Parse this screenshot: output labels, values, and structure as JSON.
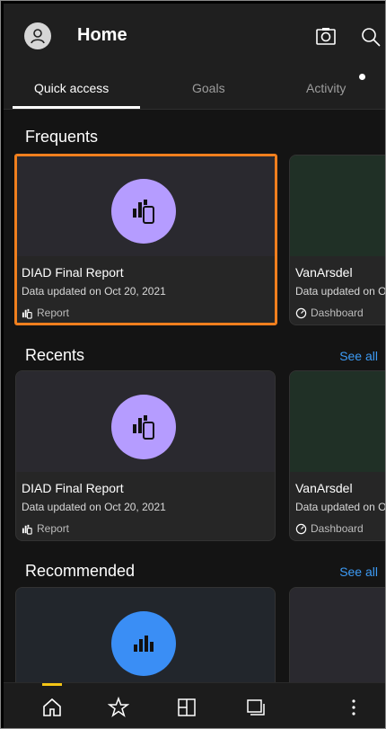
{
  "header": {
    "title": "Home",
    "icons": [
      "user-icon",
      "camera-icon",
      "search-icon"
    ]
  },
  "tabs": [
    {
      "label": "Quick access",
      "active": true
    },
    {
      "label": "Goals",
      "active": false
    },
    {
      "label": "Activity",
      "active": false,
      "has_notification_dot": true
    }
  ],
  "frequents": {
    "title": "Frequents",
    "cards": [
      {
        "name": "DIAD Final Report",
        "updated": "Data updated on Oct 20, 2021",
        "type": "Report",
        "icon": "report-icon",
        "selected": true
      },
      {
        "name": "VanArsdel",
        "updated": "Data updated on O",
        "type": "Dashboard",
        "icon": "dashboard-icon"
      }
    ]
  },
  "recents": {
    "title": "Recents",
    "see_all": "See all",
    "cards": [
      {
        "name": "DIAD Final Report",
        "updated": "Data updated on Oct 20, 2021",
        "type": "Report",
        "icon": "report-icon"
      },
      {
        "name": "VanArsdel",
        "updated": "Data updated on O",
        "type": "Dashboard",
        "icon": "dashboard-icon"
      }
    ]
  },
  "recommended": {
    "title": "Recommended",
    "see_all": "See all"
  },
  "bottom_nav": [
    {
      "name": "home-icon",
      "active": true
    },
    {
      "name": "star-icon"
    },
    {
      "name": "apps-icon"
    },
    {
      "name": "workspaces-icon"
    },
    {
      "name": "more-icon"
    }
  ],
  "colors": {
    "accent_blue": "#3d9bf5",
    "report_purple": "#b59cff",
    "selection_orange": "#f07f1e",
    "nav_active_yellow": "#f4c515"
  }
}
